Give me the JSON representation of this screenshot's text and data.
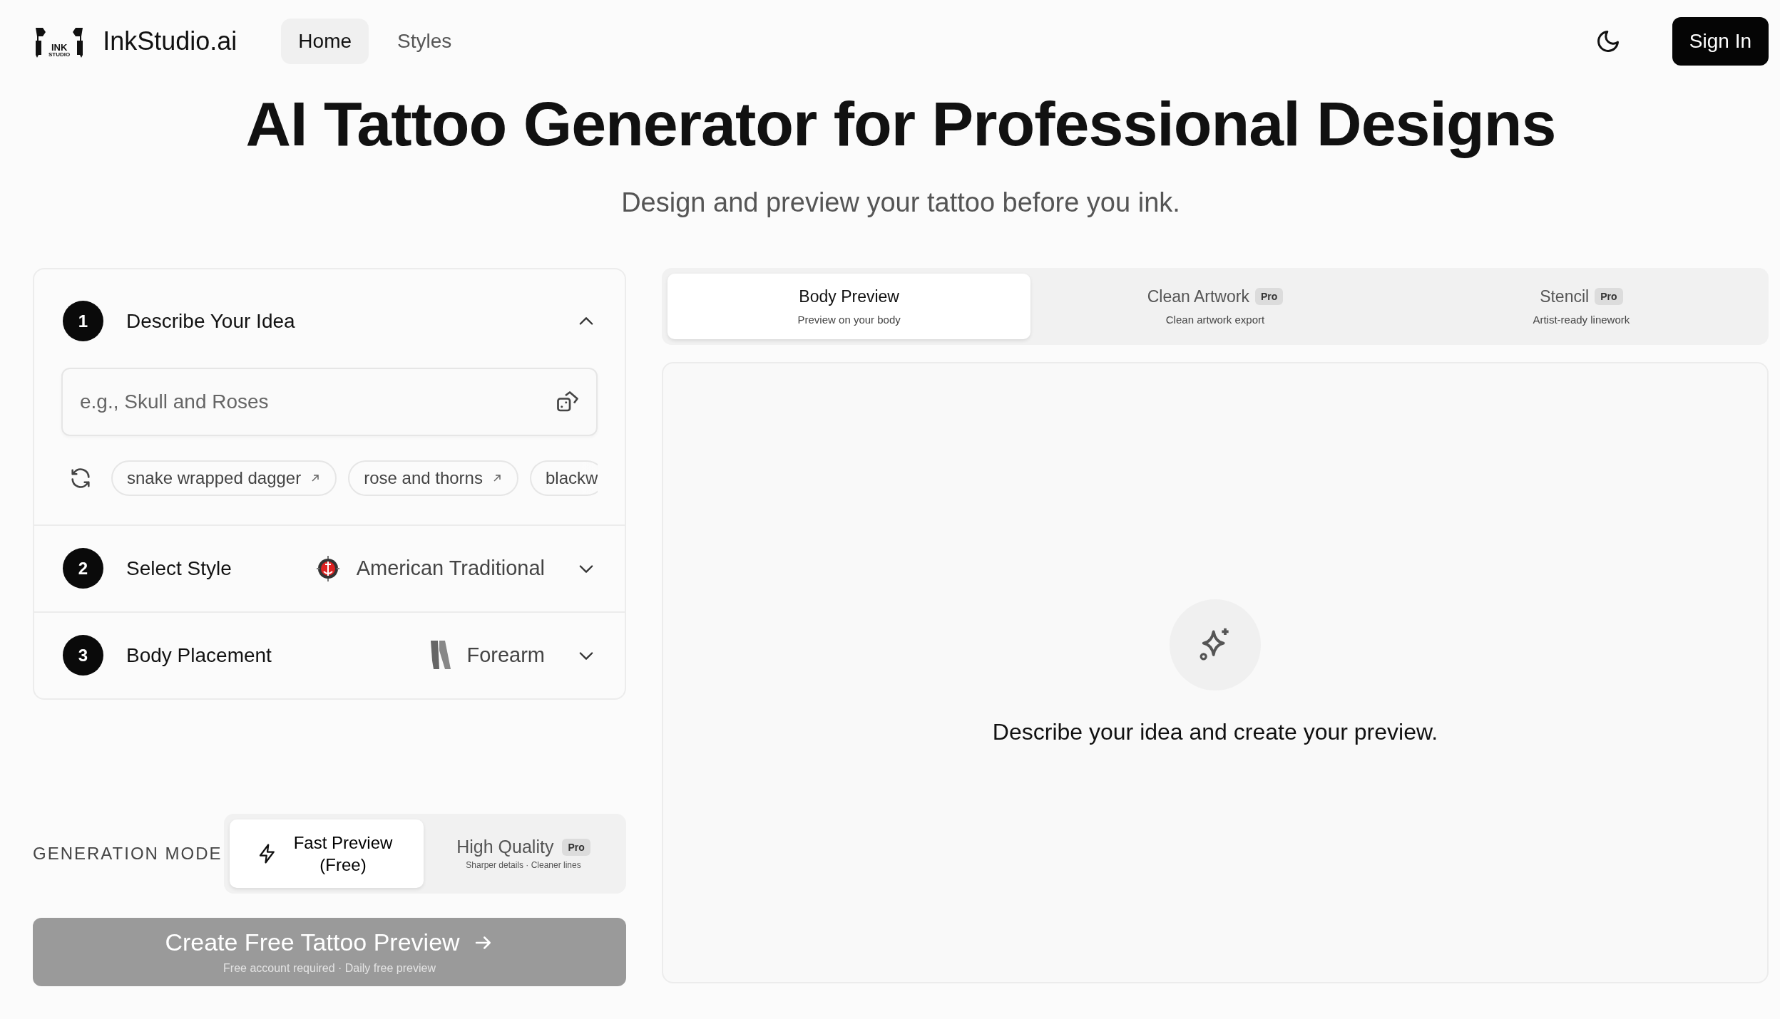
{
  "header": {
    "logo_lines": [
      "INK",
      "STUDIO"
    ],
    "brand": "InkStudio.ai",
    "nav": [
      {
        "label": "Home",
        "selected": true
      },
      {
        "label": "Styles",
        "selected": false
      }
    ],
    "sign_in": "Sign In"
  },
  "hero": {
    "title": "AI Tattoo Generator for Professional Designs",
    "subtitle": "Design and preview your tattoo before you ink."
  },
  "steps": [
    {
      "number": "1",
      "title": "Describe Your Idea",
      "expanded": true,
      "input": {
        "placeholder": "e.g., Skull and Roses"
      },
      "suggestions": [
        {
          "label": "snake wrapped dagger",
          "cut": false
        },
        {
          "label": "rose and thorns",
          "cut": false
        },
        {
          "label": "blackw",
          "cut": true
        }
      ]
    },
    {
      "number": "2",
      "title": "Select Style",
      "expanded": false,
      "value": "American Traditional",
      "kind": "style"
    },
    {
      "number": "3",
      "title": "Body Placement",
      "expanded": false,
      "value": "Forearm",
      "kind": "placement"
    }
  ],
  "generation_mode": {
    "label": "GENERATION MODE",
    "options": [
      {
        "label": "Fast Preview (Free)",
        "selected": true,
        "kind": "fast"
      },
      {
        "label": "High Quality",
        "badge": "Pro",
        "subtitle": "Sharper details · Cleaner lines",
        "selected": false,
        "kind": "quality"
      }
    ]
  },
  "create_button": {
    "label": "Create Free Tattoo Preview",
    "subtitle": "Free account required · Daily free preview",
    "disabled": true
  },
  "preview_tabs": [
    {
      "label": "Body Preview",
      "subtitle": "Preview on your body",
      "selected": true
    },
    {
      "label": "Clean Artwork",
      "badge": "Pro",
      "subtitle": "Clean artwork export",
      "selected": false
    },
    {
      "label": "Stencil",
      "badge": "Pro",
      "subtitle": "Artist-ready linework",
      "selected": false
    }
  ],
  "preview": {
    "message": "Describe your idea and create your preview."
  }
}
